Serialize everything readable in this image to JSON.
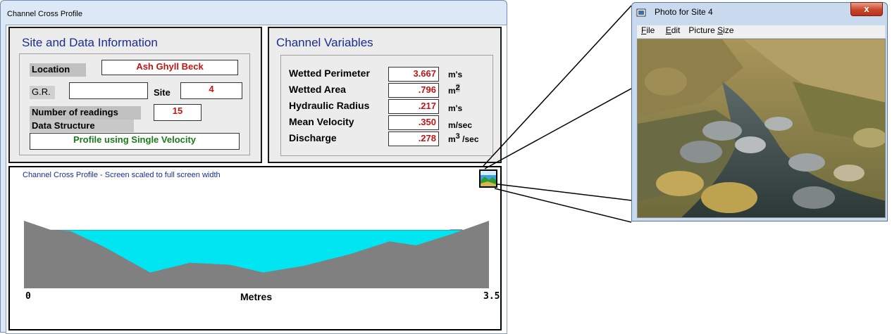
{
  "main_window": {
    "title": "Channel Cross Profile"
  },
  "site_panel": {
    "heading": "Site and Data Information",
    "location_label": "Location",
    "location_value": "Ash Ghyll Beck",
    "gr_label": "G.R.",
    "gr_value": "",
    "site_label": "Site",
    "site_value": "4",
    "readings_label": "Number of readings",
    "readings_value": "15",
    "structure_label": "Data Structure",
    "structure_value": "Profile using Single Velocity"
  },
  "variables_panel": {
    "heading": "Channel Variables",
    "rows": [
      {
        "label": "Wetted Perimeter",
        "value": "3.667",
        "unit": "m's"
      },
      {
        "label": "Wetted Area",
        "value": ".796",
        "unit": "m",
        "unit_sup": "2"
      },
      {
        "label": "Hydraulic Radius",
        "value": ".217",
        "unit": "m's"
      },
      {
        "label": "Mean Velocity",
        "value": ".350",
        "unit": "m/sec"
      },
      {
        "label": "Discharge",
        "value": ".278",
        "unit": "m",
        "unit_sup": "3",
        "unit_tail": " /sec"
      }
    ]
  },
  "profile_panel": {
    "caption": "Channel Cross Profile - Screen scaled to full screen width",
    "x_axis_label": "Metres",
    "x_start_label": "0",
    "x_end_label": "3.5",
    "photo_icon": "landscape-photo-icon"
  },
  "profile_data": {
    "x_range": [
      0,
      3.5
    ],
    "ground_points": [
      [
        0.0,
        1.0
      ],
      [
        0.2,
        0.86
      ],
      [
        0.35,
        0.84
      ],
      [
        0.6,
        0.6
      ],
      [
        0.95,
        0.2
      ],
      [
        1.25,
        0.35
      ],
      [
        1.55,
        0.32
      ],
      [
        1.8,
        0.2
      ],
      [
        2.1,
        0.3
      ],
      [
        2.45,
        0.48
      ],
      [
        2.75,
        0.68
      ],
      [
        2.95,
        0.62
      ],
      [
        3.2,
        0.78
      ],
      [
        3.5,
        1.0
      ]
    ],
    "water_level": 0.86,
    "colors": {
      "ground": "#808080",
      "water": "#00e5f2"
    }
  },
  "photo_window": {
    "title": "Photo for Site 4",
    "close_label": "x",
    "menu": [
      {
        "label": "File",
        "underline": "F"
      },
      {
        "label": "Edit",
        "underline": "E"
      },
      {
        "label": "Picture Size",
        "underline": "S"
      }
    ]
  }
}
